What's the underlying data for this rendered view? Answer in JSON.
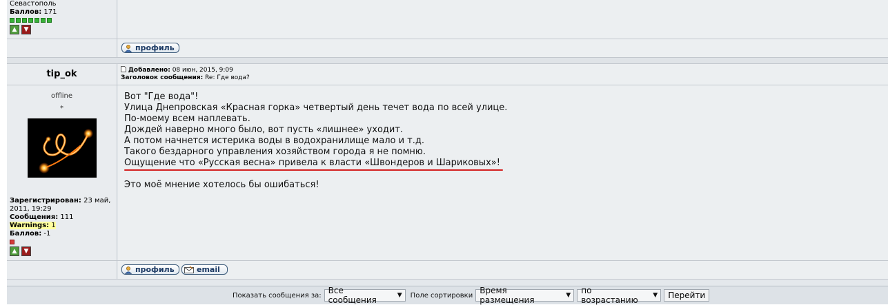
{
  "prev_post": {
    "city": "Севастополь",
    "points_label": "Баллов:",
    "points_value": "171",
    "points_boxes": 7,
    "profile_label": "профиль"
  },
  "post": {
    "author": "tip_ok",
    "status": "offline",
    "rank": "*",
    "added_label": "Добавлено:",
    "added_value": "08 июн, 2015, 9:09",
    "subject_label": "Заголовок сообщения:",
    "subject_value": "Re: Где вода?",
    "registered_label": "Зарегистрирован:",
    "registered_value": "23 май, 2011, 19:29",
    "messages_label": "Сообщения:",
    "messages_value": "111",
    "warnings_label": "Warnings:",
    "warnings_value": "1",
    "points_label": "Баллов:",
    "points_value": "-1",
    "lines": [
      "Вот \"Где вода\"!",
      "Улица Днепровская «Красная горка» четвертый день течет вода по всей улице.",
      "По-моему всем наплевать.",
      "Дождей наверно много было, вот пусть «лишнее» уходит.",
      "А потом начнется истерика воды в водохранилище мало и т.д.",
      "Такого бездарного управления хозяйством города я не помню.",
      "Ощущение что «Русская весна» привела к власти «Швондеров и Шариковых»!"
    ],
    "closing": "Это моё мнение хотелось бы ошибаться!",
    "profile_label": "профиль",
    "email_label": "email"
  },
  "footer": {
    "show_label": "Показать сообщения за:",
    "show_value": "Все сообщения",
    "sort_label": "Поле сортировки",
    "sort_value": "Время размещения",
    "order_value": "по возрастанию",
    "go_label": "Перейти"
  },
  "colors": {
    "points_green": "#38b138",
    "points_red": "#d43a3a",
    "highlight_red_line": "#d42020",
    "warnings_highlight": "#fffe9f"
  }
}
